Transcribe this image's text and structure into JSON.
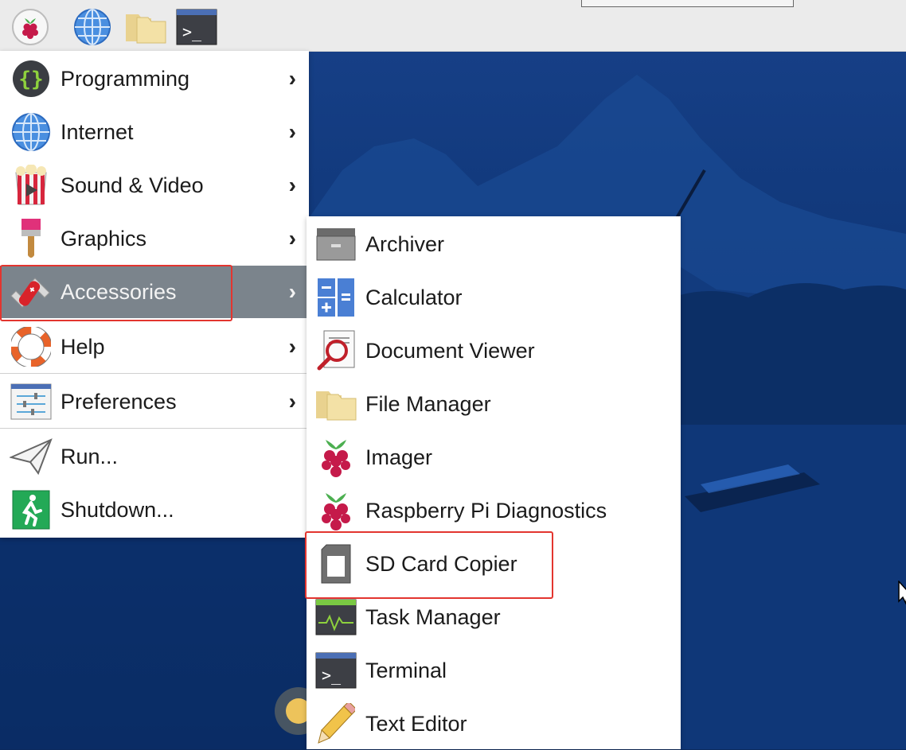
{
  "taskbar": {
    "icons": [
      "raspberry-menu-icon",
      "web-browser-icon",
      "file-manager-icon",
      "terminal-icon"
    ]
  },
  "main_menu": {
    "items": [
      {
        "label": "Programming",
        "icon": "programming-icon",
        "has_submenu": true
      },
      {
        "label": "Internet",
        "icon": "internet-icon",
        "has_submenu": true
      },
      {
        "label": "Sound & Video",
        "icon": "sound-video-icon",
        "has_submenu": true
      },
      {
        "label": "Graphics",
        "icon": "graphics-icon",
        "has_submenu": true
      },
      {
        "label": "Accessories",
        "icon": "accessories-icon",
        "has_submenu": true,
        "selected": true
      },
      {
        "label": "Help",
        "icon": "help-icon",
        "has_submenu": true
      },
      {
        "label": "Preferences",
        "icon": "preferences-icon",
        "has_submenu": true
      },
      {
        "label": "Run...",
        "icon": "run-icon",
        "has_submenu": false
      },
      {
        "label": "Shutdown...",
        "icon": "shutdown-icon",
        "has_submenu": false
      }
    ],
    "arrow": "›"
  },
  "accessories_menu": {
    "items": [
      {
        "label": "Archiver",
        "icon": "archiver-icon"
      },
      {
        "label": "Calculator",
        "icon": "calculator-icon"
      },
      {
        "label": "Document Viewer",
        "icon": "document-viewer-icon"
      },
      {
        "label": "File Manager",
        "icon": "folder-icon"
      },
      {
        "label": "Imager",
        "icon": "raspberry-icon"
      },
      {
        "label": "Raspberry Pi Diagnostics",
        "icon": "raspberry-icon"
      },
      {
        "label": "SD Card Copier",
        "icon": "sd-card-icon",
        "highlighted": true
      },
      {
        "label": "Task Manager",
        "icon": "task-manager-icon"
      },
      {
        "label": "Terminal",
        "icon": "terminal-icon"
      },
      {
        "label": "Text Editor",
        "icon": "text-editor-icon"
      }
    ]
  },
  "colors": {
    "selected_bg": "#7b848c",
    "highlight_box": "#e3352f",
    "taskbar_bg": "#ebebeb"
  }
}
